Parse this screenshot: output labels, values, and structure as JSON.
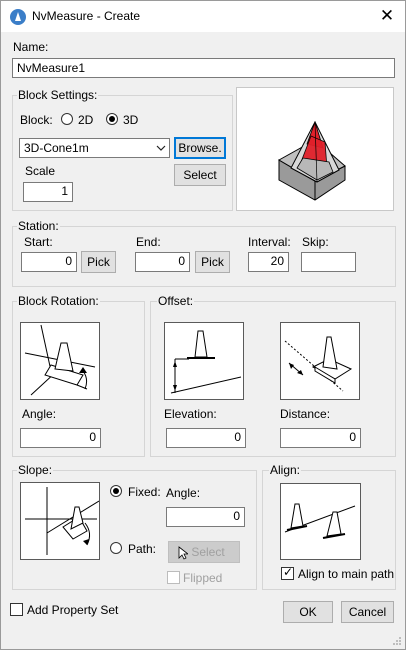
{
  "window": {
    "title": "NvMeasure - Create",
    "close_glyph": "✕"
  },
  "name": {
    "label": "Name:",
    "value": "NvMeasure1"
  },
  "block_settings": {
    "label": "Block Settings:",
    "block_label": "Block:",
    "option_2d": "2D",
    "option_3d": "3D",
    "selected": "3D",
    "block_value": "3D-Cone1m",
    "browse_label": "Browse.",
    "scale_label": "Scale",
    "scale_value": "1",
    "select_label": "Select"
  },
  "station": {
    "label": "Station:",
    "start_label": "Start:",
    "start_value": "0",
    "start_pick": "Pick",
    "end_label": "End:",
    "end_value": "0",
    "end_pick": "Pick",
    "interval_label": "Interval:",
    "interval_value": "20",
    "skip_label": "Skip:",
    "skip_value": ""
  },
  "block_rotation": {
    "label": "Block Rotation:",
    "angle_label": "Angle:",
    "angle_value": "0"
  },
  "offset": {
    "label": "Offset:",
    "elevation_label": "Elevation:",
    "elevation_value": "0",
    "distance_label": "Distance:",
    "distance_value": "0"
  },
  "slope": {
    "label": "Slope:",
    "fixed_label": "Fixed:",
    "path_label": "Path:",
    "selected": "Fixed",
    "angle_label": "Angle:",
    "angle_value": "0",
    "select_label": "Select",
    "flipped_label": "Flipped"
  },
  "align": {
    "label": "Align:",
    "align_main_label": "Align to main path",
    "align_main_checked": true
  },
  "footer": {
    "add_property_set_label": "Add Property Set",
    "ok_label": "OK",
    "cancel_label": "Cancel"
  },
  "icons": [
    "app-icon",
    "close-icon",
    "chevron-down-icon",
    "cone-3d-preview",
    "size-grip-icon"
  ],
  "colors": {
    "focus_blue": "#0078d7",
    "cone_red": "#e0202a"
  }
}
